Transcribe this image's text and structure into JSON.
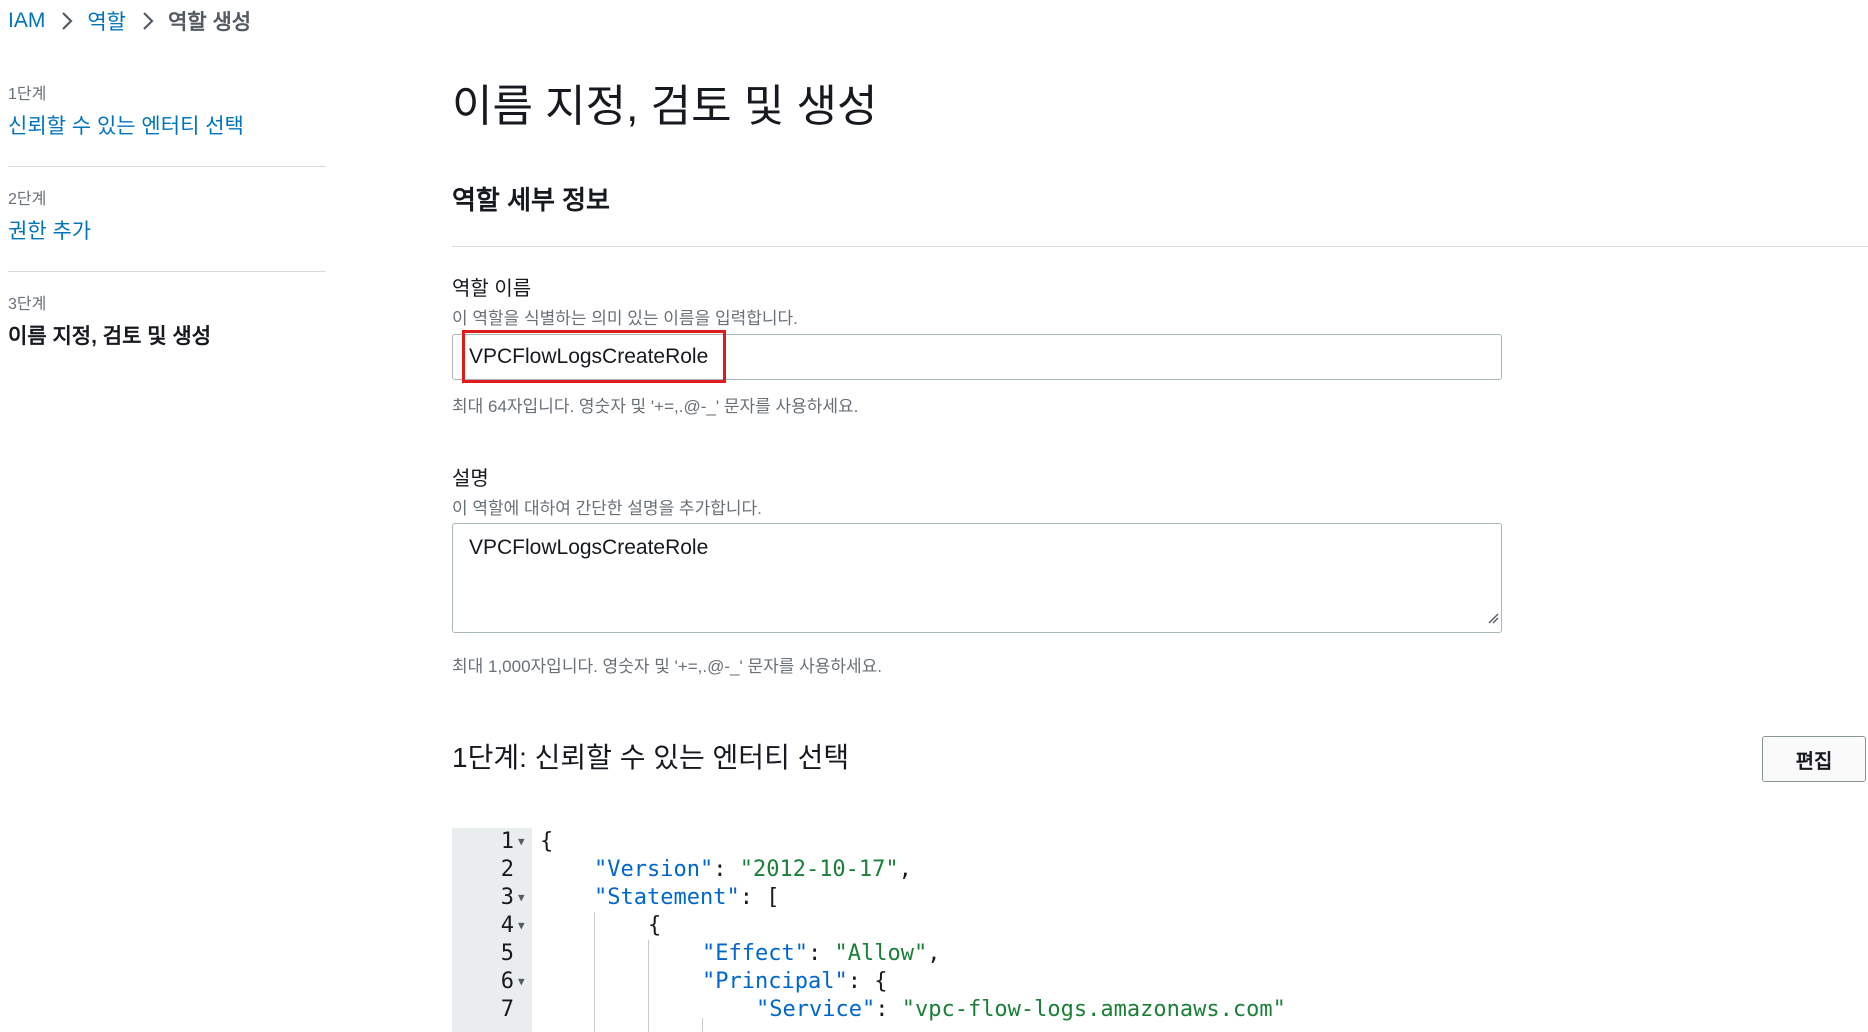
{
  "breadcrumb": {
    "items": [
      "IAM",
      "역할"
    ],
    "current": "역할 생성"
  },
  "steps": [
    {
      "num": "1단계",
      "title": "신뢰할 수 있는 엔터티 선택"
    },
    {
      "num": "2단계",
      "title": "권한 추가"
    },
    {
      "num": "3단계",
      "title": "이름 지정, 검토 및 생성"
    }
  ],
  "page": {
    "title": "이름 지정, 검토 및 생성",
    "section_header": "역할 세부 정보"
  },
  "role_name": {
    "label": "역할 이름",
    "description": "이 역할을 식별하는 의미 있는 이름을 입력합니다.",
    "value": "VPCFlowLogsCreateRole",
    "constraint": "최대 64자입니다. 영숫자 및 '+=,.@-_' 문자를 사용하세요."
  },
  "role_description": {
    "label": "설명",
    "description": "이 역할에 대하여 간단한 설명을 추가합니다.",
    "value": "VPCFlowLogsCreateRole",
    "constraint": "최대 1,000자입니다. 영숫자 및 '+=,.@-_' 문자를 사용하세요."
  },
  "trust_step": {
    "title": "1단계: 신뢰할 수 있는 엔터티 선택",
    "edit_label": "편집"
  },
  "code": {
    "line_numbers": [
      "1",
      "2",
      "3",
      "4",
      "5",
      "6",
      "7"
    ],
    "line1": "{",
    "line2_key": "\"Version\"",
    "line2_sep": ": ",
    "line2_val": "\"2012-10-17\"",
    "line2_end": ",",
    "line3_key": "\"Statement\"",
    "line3_end": ": [",
    "line4": "{",
    "line5_key": "\"Effect\"",
    "line5_sep": ": ",
    "line5_val": "\"Allow\"",
    "line5_end": ",",
    "line6_key": "\"Principal\"",
    "line6_end": ": {",
    "line7_key": "\"Service\"",
    "line7_sep": ": ",
    "line7_val": "\"vpc-flow-logs.amazonaws.com\""
  },
  "colors": {
    "link": "#0073bb",
    "highlight": "#e01b1b",
    "json_key": "#0066cc",
    "json_string": "#1a7f37"
  }
}
